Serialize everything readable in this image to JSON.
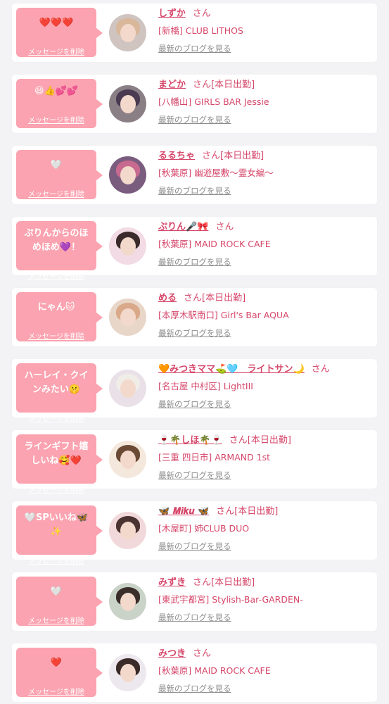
{
  "delete_label": "メッセージを削除",
  "blog_label": "最新のブログを見る",
  "san_label": "さん",
  "working_label": "[本日出勤]",
  "items": [
    {
      "message": "❤️❤️❤️",
      "name": "しずか",
      "working": false,
      "shop": "[新橋] CLUB LITHOS",
      "avatar_bg": "#cfc4bf",
      "avatar_hair": "#d9b79a"
    },
    {
      "message": "😆👍💕💕",
      "name": "まどか",
      "working": true,
      "shop": "[八幡山] GIRLS BAR Jessie",
      "avatar_bg": "#8b7f86",
      "avatar_hair": "#4a3a52"
    },
    {
      "message": "🤍",
      "name": "るるちゃ",
      "working": true,
      "shop": "[秋葉原] 幽遊屋敷～霊女編～",
      "avatar_bg": "#7a5c7f",
      "avatar_hair": "#c86a8f"
    },
    {
      "message": "ぷりんからのほめほめ💜！",
      "name": "ぷりん🎤🎀",
      "working": false,
      "shop": "[秋葉原] MAID ROCK CAFE",
      "avatar_bg": "#f2dbe4",
      "avatar_hair": "#3a2a2a"
    },
    {
      "message": "にゃん🐱",
      "name": "める",
      "working": true,
      "shop": "[本厚木駅南口] Girl's Bar AQUA",
      "avatar_bg": "#e8d6c9",
      "avatar_hair": "#d9a98a"
    },
    {
      "message": "ハーレイ・クインみたい🤫",
      "name": "🧡みつきママ⛳️🩵　ライトサン🌙",
      "working": false,
      "shop": "[名古屋 中村区] LightIII",
      "avatar_bg": "#e9e1e7",
      "avatar_hair": "#f0ece8"
    },
    {
      "message": "ラインギフト嬉しいね🥰❤️",
      "name": "🍷🌴しほ🌴🍷",
      "working": true,
      "shop": "[三重 四日市] ARMAND 1st",
      "avatar_bg": "#f4e7dc",
      "avatar_hair": "#6b4a35"
    },
    {
      "message": "🤍SPいいね🦋✨",
      "name": "🦋 𝑴𝒊𝒌𝒖 🦋",
      "working": true,
      "shop": "[木屋町] 姉CLUB DUO",
      "avatar_bg": "#f1d9db",
      "avatar_hair": "#4a3330"
    },
    {
      "message": "🤍",
      "name": "みずき",
      "working": true,
      "shop": "[東武宇都宮] Stylish-Bar-GARDEN-",
      "avatar_bg": "#c9d3c7",
      "avatar_hair": "#3b2e2a"
    },
    {
      "message": "❤️",
      "name": "みつき",
      "working": false,
      "shop": "[秋葉原] MAID ROCK CAFE",
      "avatar_bg": "#ede8ee",
      "avatar_hair": "#3a2a28"
    }
  ]
}
